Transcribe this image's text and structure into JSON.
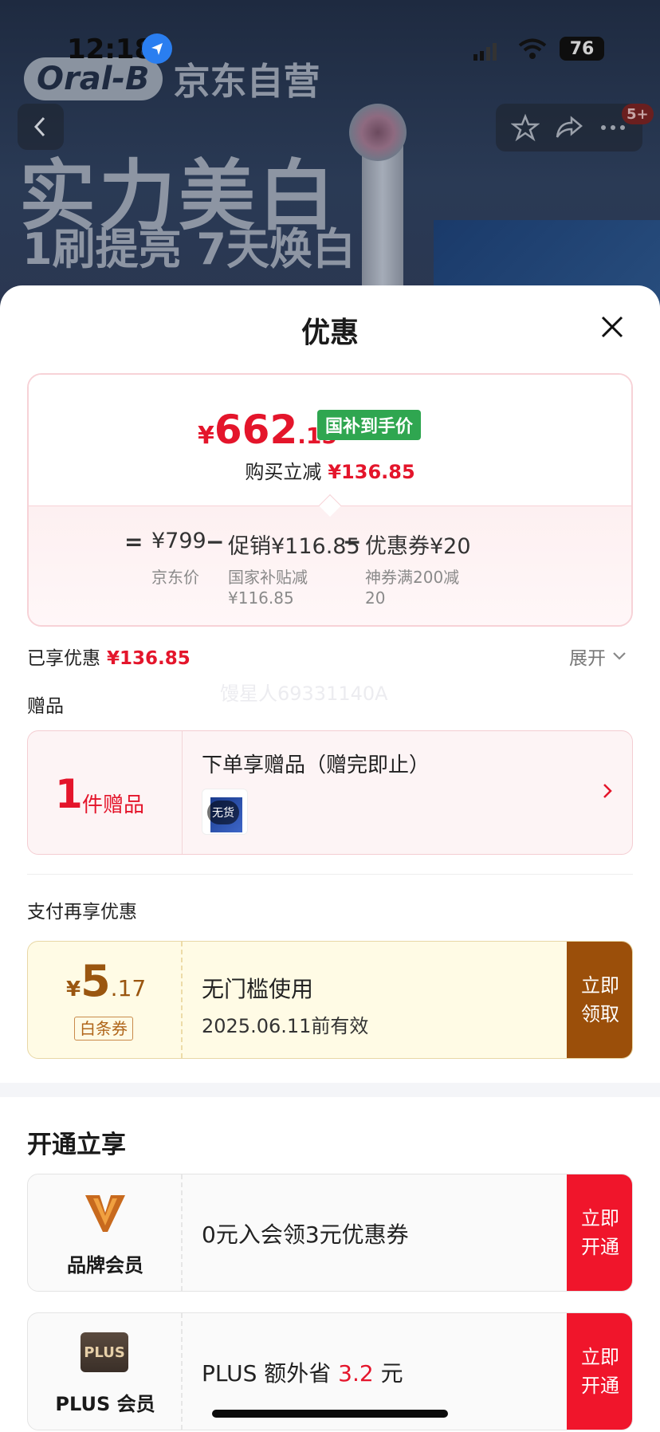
{
  "status_bar": {
    "time": "12:18",
    "battery": "76",
    "icons": [
      "location-icon",
      "signal-icon",
      "wifi-icon",
      "battery-icon"
    ]
  },
  "background": {
    "brand_logo_text": "Oral-B",
    "store_text": "京东自营",
    "headline": "实力美白",
    "subheadline": "1刷提亮 7天焕白",
    "cart_badge": "5+",
    "icons": [
      "back-icon",
      "star-icon",
      "share-icon",
      "more-icon"
    ]
  },
  "sheet": {
    "title": "优惠"
  },
  "price_card": {
    "currency": "¥",
    "final_int": "662",
    "final_dec": ".15",
    "tag": "国补到手价",
    "buy_reduce_label": "购买立减",
    "buy_reduce_value": "¥136.85",
    "formula": {
      "equals": "=",
      "minus": "−",
      "items": [
        {
          "value": "¥799",
          "label": "京东价"
        },
        {
          "value": "促销¥116.85",
          "label": "国家补贴减\n¥116.85"
        },
        {
          "value": "优惠券¥20",
          "label": "神券满200减\n20"
        }
      ]
    }
  },
  "enjoyed": {
    "label": "已享优惠",
    "value": "¥136.85",
    "expand": "展开"
  },
  "watermark": "馒星人69331140A",
  "gift": {
    "section_label": "赠品",
    "count": "1",
    "unit": "件赠品",
    "title": "下单享赠品（赠完即止）",
    "thumb_badge": "无货"
  },
  "pay": {
    "section_label": "支付再享优惠",
    "coupon": {
      "currency": "¥",
      "int": "5",
      "dec": ".17",
      "tag": "白条券",
      "title": "无门槛使用",
      "expire": "2025.06.11前有效",
      "button": "立即领取"
    }
  },
  "open": {
    "title": "开通立享",
    "cards": [
      {
        "name": "品牌会员",
        "desc_prefix": "0元入会领3元优惠券",
        "desc_highlight": "",
        "desc_suffix": "",
        "button": "立即开通",
        "logo": "brand-v-logo"
      },
      {
        "name": "PLUS 会员",
        "logo_text": "PLUS",
        "desc_prefix": "PLUS 额外省 ",
        "desc_highlight": "3.2",
        "desc_suffix": " 元",
        "button": "立即开通",
        "logo": "plus-logo"
      }
    ]
  },
  "colors": {
    "accent_red": "#e4152b",
    "guobu_green": "#2fa650",
    "coupon_brown": "#9b4f0a",
    "open_red": "#f0152b"
  }
}
